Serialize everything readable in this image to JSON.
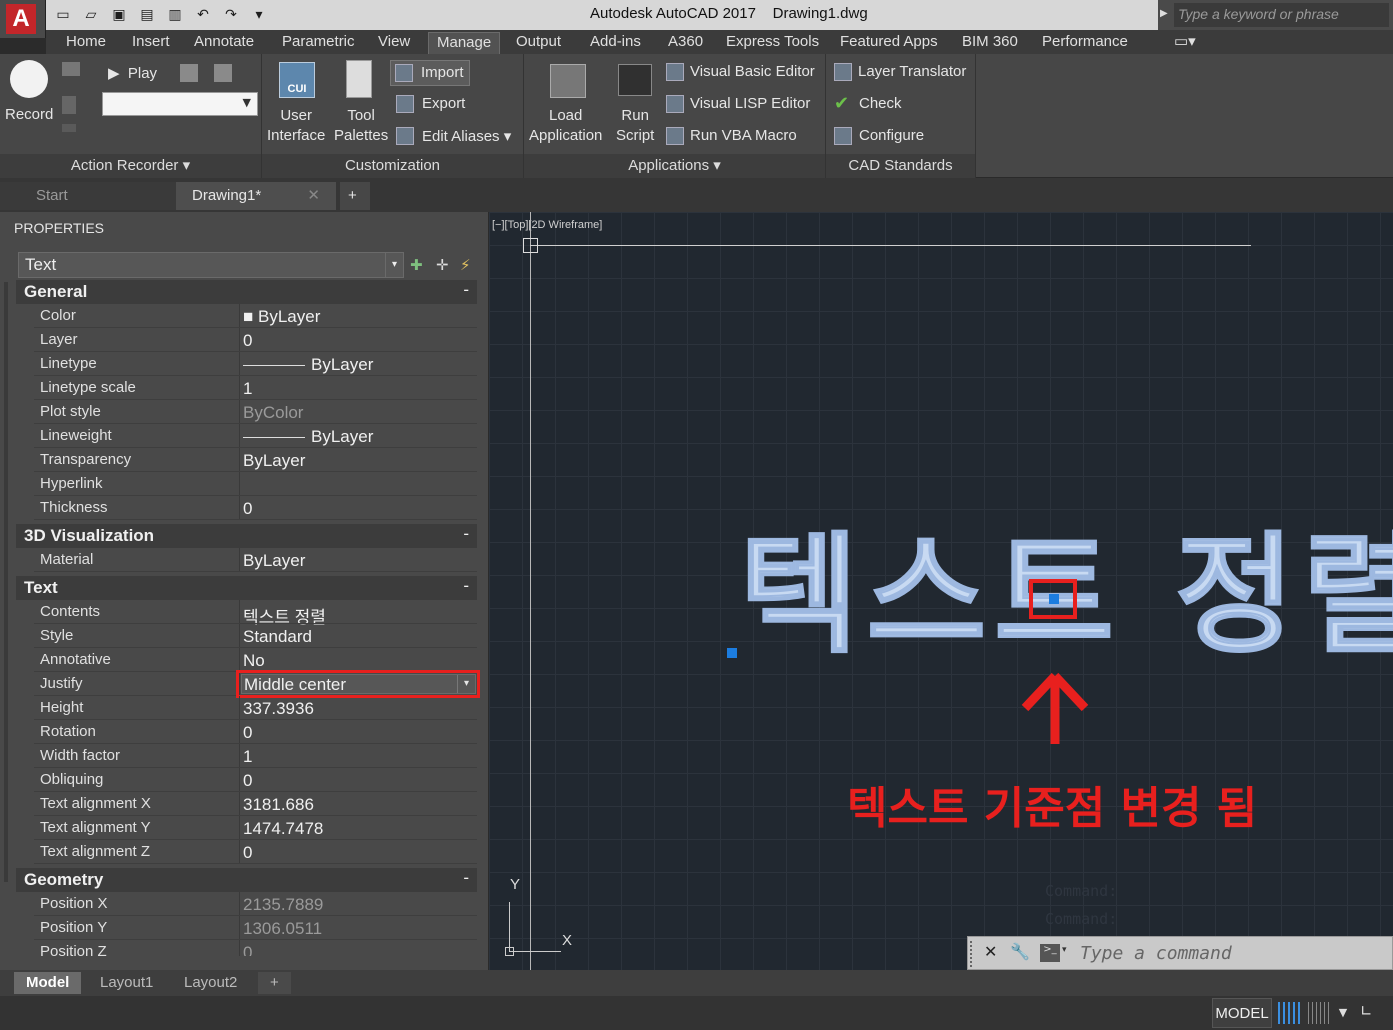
{
  "app": {
    "logo": "A",
    "title": "Autodesk AutoCAD 2017",
    "document": "Drawing1.dwg"
  },
  "search": {
    "placeholder": "Type a keyword or phrase"
  },
  "ribbon_tabs": [
    "Home",
    "Insert",
    "Annotate",
    "Parametric",
    "View",
    "Manage",
    "Output",
    "Add-ins",
    "A360",
    "Express Tools",
    "Featured Apps",
    "BIM 360",
    "Performance"
  ],
  "active_ribbon_tab": "Manage",
  "action_recorder": {
    "record_label": "Record",
    "play_label": "Play",
    "panel_title": "Action Recorder ▾"
  },
  "customization": {
    "user_interface": "User\nInterface",
    "tool_palettes": "Tool\nPalettes",
    "import": "Import",
    "export": "Export",
    "edit_aliases": "Edit Aliases ▾",
    "panel_title": "Customization",
    "cui_tag": "CUI"
  },
  "applications": {
    "load_application": "Load\nApplication",
    "run_script": "Run\nScript",
    "vba_editor": "Visual Basic Editor",
    "lisp_editor": "Visual LISP Editor",
    "run_vba": "Run VBA Macro",
    "panel_title": "Applications ▾"
  },
  "cad_standards": {
    "layer_translator": "Layer Translator",
    "check": "Check",
    "configure": "Configure",
    "panel_title": "CAD Standards"
  },
  "doc_tabs": {
    "start": "Start",
    "drawing": "Drawing1*",
    "add": "+"
  },
  "properties": {
    "title": "PROPERTIES",
    "object_type": "Text",
    "general": {
      "heading": "General",
      "rows": [
        {
          "name": "Color",
          "value": "■ ByLayer"
        },
        {
          "name": "Layer",
          "value": "0"
        },
        {
          "name": "Linetype",
          "value": "ByLayer"
        },
        {
          "name": "Linetype scale",
          "value": "1"
        },
        {
          "name": "Plot style",
          "value": "ByColor"
        },
        {
          "name": "Lineweight",
          "value": "ByLayer"
        },
        {
          "name": "Transparency",
          "value": "ByLayer"
        },
        {
          "name": "Hyperlink",
          "value": ""
        },
        {
          "name": "Thickness",
          "value": "0"
        }
      ]
    },
    "viz3d": {
      "heading": "3D Visualization",
      "rows": [
        {
          "name": "Material",
          "value": "ByLayer"
        }
      ]
    },
    "text": {
      "heading": "Text",
      "rows": [
        {
          "name": "Contents",
          "value": "텍스트 정렬"
        },
        {
          "name": "Style",
          "value": "Standard"
        },
        {
          "name": "Annotative",
          "value": "No"
        },
        {
          "name": "Justify",
          "value": "Middle center"
        },
        {
          "name": "Height",
          "value": "337.3936"
        },
        {
          "name": "Rotation",
          "value": "0"
        },
        {
          "name": "Width factor",
          "value": "1"
        },
        {
          "name": "Obliquing",
          "value": "0"
        },
        {
          "name": "Text alignment X",
          "value": "3181.686"
        },
        {
          "name": "Text alignment Y",
          "value": "1474.7478"
        },
        {
          "name": "Text alignment Z",
          "value": "0"
        }
      ]
    },
    "geometry": {
      "heading": "Geometry",
      "rows": [
        {
          "name": "Position X",
          "value": "2135.7889"
        },
        {
          "name": "Position Y",
          "value": "1306.0511"
        },
        {
          "name": "Position Z",
          "value": "0"
        }
      ]
    },
    "collapse_symbol": "-"
  },
  "canvas": {
    "viewport_label": "[−][Top][2D Wireframe]",
    "drawing_text": "텍스트 정렬",
    "annotation": "텍스트 기준점 변경 됨",
    "annotation_color": "#e8201e",
    "text_color": "#c8daf2",
    "axis_x": "X",
    "axis_y": "Y",
    "command_history": [
      "Command:",
      "Command:"
    ],
    "command_placeholder": "Type a command"
  },
  "layout_tabs": [
    "Model",
    "Layout1",
    "Layout2",
    "+"
  ],
  "status": {
    "model_label": "MODEL"
  }
}
